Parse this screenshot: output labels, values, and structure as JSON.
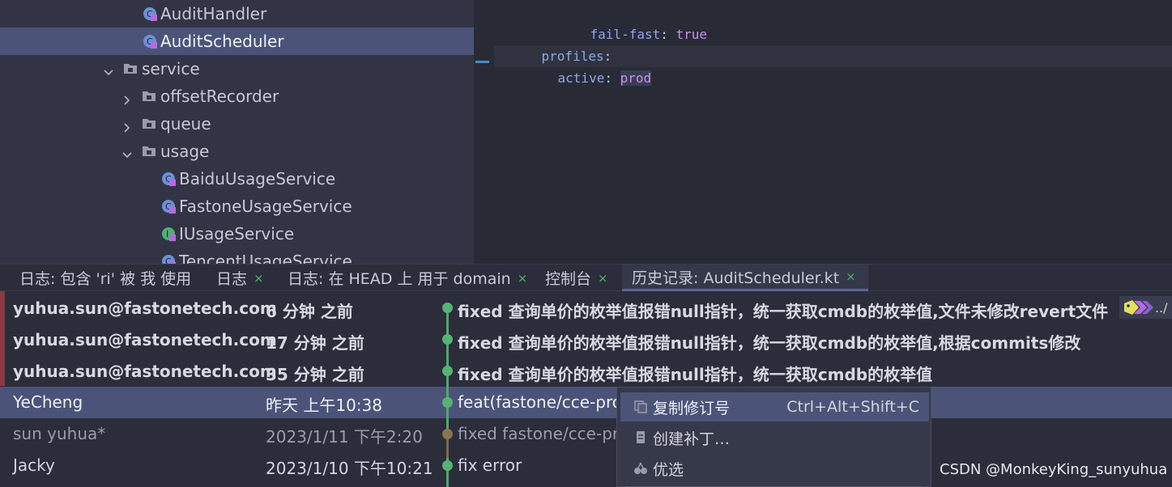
{
  "tree": {
    "items": [
      {
        "label": "AuditHandler"
      },
      {
        "label": "AuditScheduler"
      },
      {
        "label": "service"
      },
      {
        "label": "offsetRecorder"
      },
      {
        "label": "queue"
      },
      {
        "label": "usage"
      },
      {
        "label": "BaiduUsageService"
      },
      {
        "label": "FastoneUsageService"
      },
      {
        "label": "IUsageService"
      },
      {
        "label": "TencentUsageService"
      }
    ]
  },
  "editor": {
    "line1_key": "fail-fast",
    "line1_sep": ":",
    "line1_val": "true",
    "line2_key": "profiles",
    "line2_sep": ":",
    "line3_key": "active",
    "line3_sep": ":",
    "line3_val": "prod"
  },
  "tabs": [
    {
      "label": "日志: 包含 'ri' 被 我 使用"
    },
    {
      "label": "日志"
    },
    {
      "label": "日志: 在 HEAD 上 用于 domain"
    },
    {
      "label": "控制台"
    },
    {
      "label": "历史记录: AuditScheduler.kt"
    }
  ],
  "tab_close_glyph": "×",
  "log": {
    "rows": [
      {
        "author": "yuhua.sun@fastonetech.com",
        "date": "6 分钟 之前",
        "message": "fixed 查询单价的枚举值报错null指针，统一获取cmdb的枚举值,文件未修改revert文件"
      },
      {
        "author": "yuhua.sun@fastonetech.com",
        "date": "17 分钟 之前",
        "message": "fixed 查询单价的枚举值报错null指针，统一获取cmdb的枚举值,根据commits修改"
      },
      {
        "author": "yuhua.sun@fastonetech.com",
        "date": "35 分钟 之前",
        "message": "fixed 查询单价的枚举值报错null指针，统一获取cmdb的枚举值"
      },
      {
        "author": "YeCheng",
        "date": "昨天 上午10:38",
        "message": "feat(fastone/cce-proj"
      },
      {
        "author": "sun yuhua*",
        "date": "2023/1/11 下午2:20",
        "message": "fixed fastone/cce-pro"
      },
      {
        "author": "Jacky",
        "date": "2023/1/10 下午10:21",
        "message": "fix error"
      }
    ],
    "tag_text": "../"
  },
  "context_menu": {
    "items": [
      {
        "label": "复制修订号",
        "shortcut": "Ctrl+Alt+Shift+C"
      },
      {
        "label": "创建补丁…",
        "shortcut": ""
      },
      {
        "label": "优选",
        "shortcut": ""
      }
    ]
  },
  "watermark": "CSDN @MonkeyKing_sunyuhua",
  "colors": {
    "selection": "#4b5478",
    "graph_green": "#55b472",
    "unpushed_marker": "#8b3a45"
  }
}
